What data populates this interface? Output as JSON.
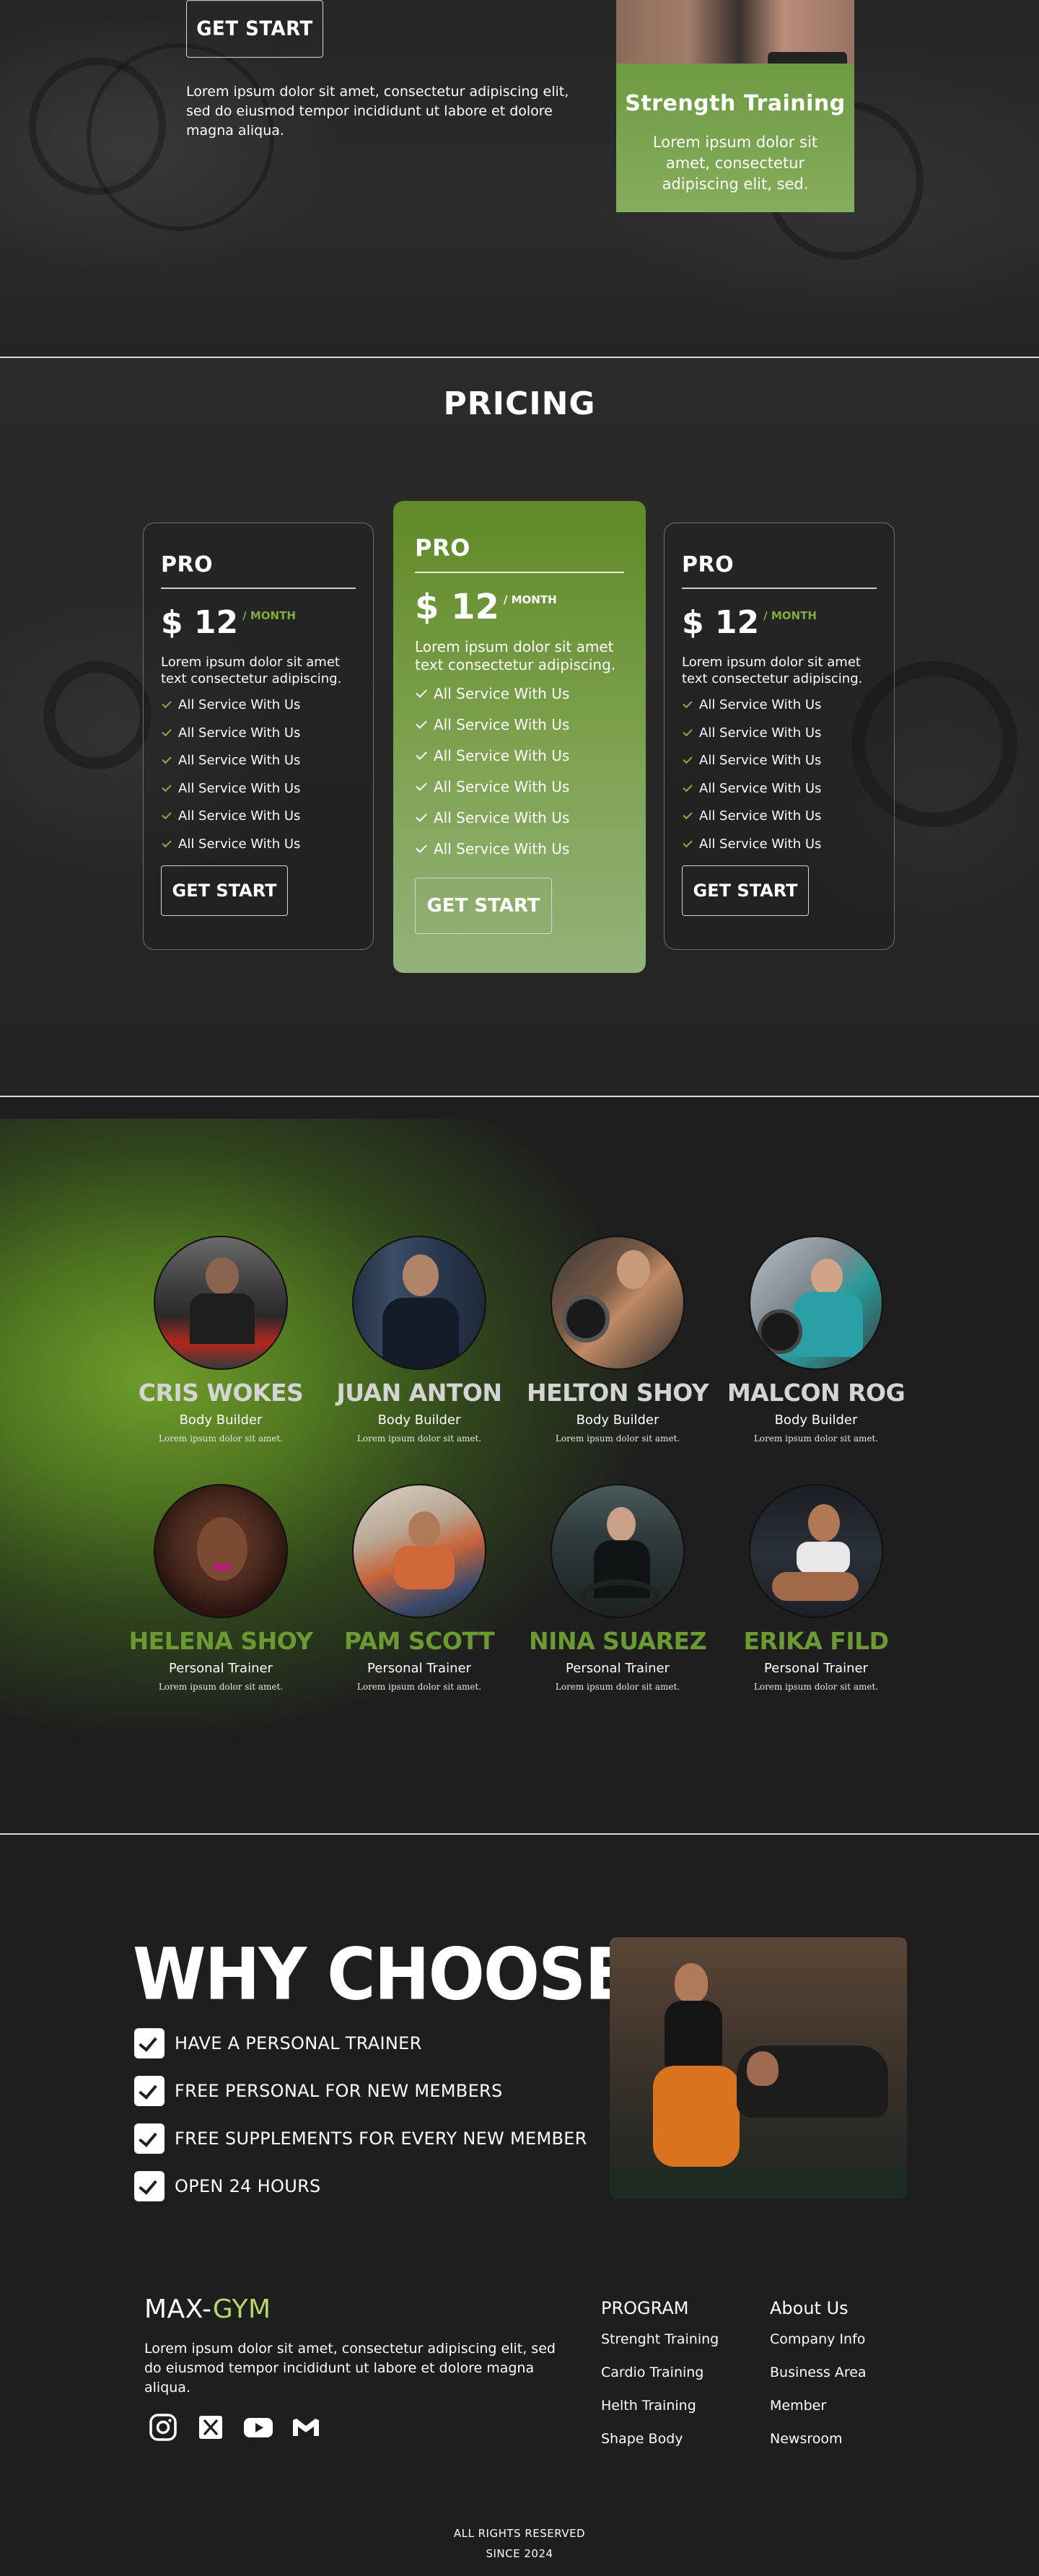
{
  "hero": {
    "cta_label": "GET START",
    "text": "Lorem ipsum dolor sit amet, consectetur adipiscing elit, sed do eiusmod tempor incididunt ut labore et dolore magna aliqua.",
    "card": {
      "title": "Strength Training",
      "text": "Lorem ipsum dolor sit amet, consectetur adipiscing elit, sed."
    }
  },
  "pricing": {
    "title": "PRICING",
    "plans": [
      {
        "name": "PRO",
        "price": "$ 12",
        "period": "/ MONTH",
        "desc": "Lorem ipsum dolor sit amet text consectetur adipiscing.",
        "features": [
          "All Service With Us",
          "All Service With Us",
          "All Service With Us",
          "All Service With Us",
          "All Service With Us",
          "All Service With Us"
        ],
        "cta": "GET START"
      },
      {
        "name": "PRO",
        "price": "$ 12",
        "period": "/ MONTH",
        "desc": "Lorem ipsum dolor sit amet text consectetur adipiscing.",
        "features": [
          "All Service With Us",
          "All Service With Us",
          "All Service With Us",
          "All Service With Us",
          "All Service With Us",
          "All Service With Us"
        ],
        "cta": "GET START"
      },
      {
        "name": "PRO",
        "price": "$ 12",
        "period": "/ MONTH",
        "desc": "Lorem ipsum dolor sit amet text consectetur adipiscing.",
        "features": [
          "All Service With Us",
          "All Service With Us",
          "All Service With Us",
          "All Service With Us",
          "All Service With Us",
          "All Service With Us"
        ],
        "cta": "GET START"
      }
    ]
  },
  "team": {
    "members": [
      {
        "name": "CRIS WOKES",
        "role": "Body Builder",
        "bio": "Lorem ipsum dolor sit amet."
      },
      {
        "name": "JUAN ANTON",
        "role": "Body Builder",
        "bio": "Lorem ipsum dolor sit amet."
      },
      {
        "name": "HELTON SHOY",
        "role": "Body Builder",
        "bio": "Lorem ipsum dolor sit amet."
      },
      {
        "name": "MALCON ROG",
        "role": "Body Builder",
        "bio": "Lorem ipsum dolor sit amet."
      },
      {
        "name": "HELENA SHOY",
        "role": "Personal Trainer",
        "bio": "Lorem ipsum dolor sit amet."
      },
      {
        "name": "PAM SCOTT",
        "role": "Personal Trainer",
        "bio": "Lorem ipsum dolor sit amet."
      },
      {
        "name": "NINA SUAREZ",
        "role": "Personal Trainer",
        "bio": "Lorem ipsum dolor sit amet."
      },
      {
        "name": "ERIKA FILD",
        "role": "Personal Trainer",
        "bio": "Lorem ipsum dolor sit amet."
      }
    ]
  },
  "why": {
    "title": "WHY CHOOSE US ?",
    "items": [
      "HAVE A PERSONAL TRAINER",
      "FREE PERSONAL FOR NEW MEMBERS",
      "FREE SUPPLEMENTS FOR EVERY NEW MEMBER",
      "OPEN 24 HOURS"
    ]
  },
  "footer": {
    "logo_main": "MAX-",
    "logo_accent": "GYM",
    "about": "Lorem ipsum dolor sit amet, consectetur adipiscing elit, sed do eiusmod tempor incididunt ut labore et dolore magna aliqua.",
    "socials": [
      "instagram-icon",
      "x-icon",
      "youtube-icon",
      "gmail-icon"
    ],
    "program": {
      "heading": "PROGRAM",
      "links": [
        "Strenght Training",
        "Cardio Training",
        "Helth Training",
        "Shape Body"
      ]
    },
    "about_us": {
      "heading": "About Us",
      "links": [
        "Company Info",
        "Business Area",
        "Member",
        "Newsroom"
      ]
    },
    "rights": "ALL RIGHTS RESERVED",
    "since": "SINCE 2024"
  },
  "colors": {
    "accent": "#6c9a32",
    "logo_accent": "#b5d96b",
    "background": "#1e1e1e"
  }
}
